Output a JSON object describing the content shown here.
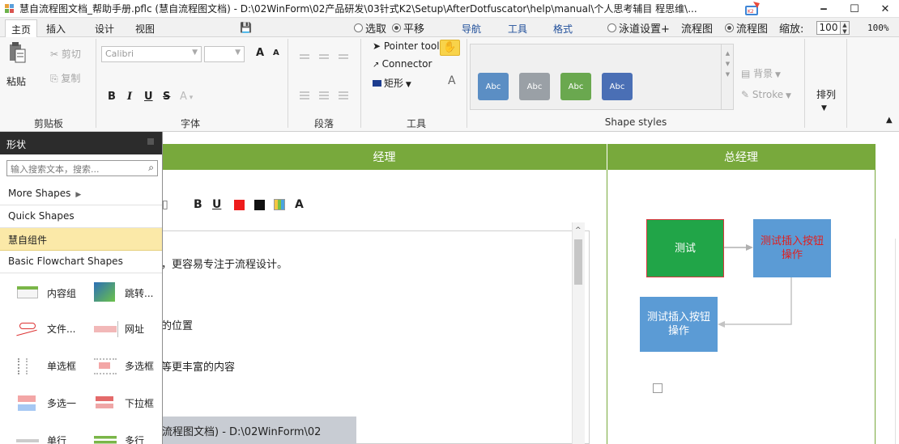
{
  "window": {
    "title": "慧自流程图文档_帮助手册.pflc (慧自流程图文档) - D:\\02WinForm\\02产品研发\\03针式K2\\Setup\\AfterDotfuscator\\help\\manual\\个人思考辅目   程思维\\...",
    "minimize": "‒",
    "maximize": "☐",
    "close": "✕"
  },
  "menu": {
    "tabs": [
      "主页",
      "插入",
      "设计",
      "视图"
    ],
    "save_icon": "💾",
    "select_label": "选取",
    "pan_label": "平移",
    "nav_label": "导航",
    "tools_label": "工具",
    "format_label": "格式",
    "swimlane_label": "泳道设置+",
    "flowchart_label1": "流程图",
    "flowchart_label2": "流程图",
    "zoom_label": "缩放:",
    "zoom_value": "100",
    "zoom_pct": "100%"
  },
  "ribbon": {
    "clipboard": {
      "paste": "粘贴",
      "cut": "剪切",
      "copy": "复制",
      "group": "剪贴板"
    },
    "font": {
      "font_name": "Calibri",
      "grow": "A",
      "shrink": "A",
      "bold": "B",
      "italic": "I",
      "underline": "U",
      "strike": "S",
      "color": "A",
      "group": "字体"
    },
    "paragraph": {
      "group": "段落"
    },
    "tools": {
      "pointer": "Pointer tool",
      "connector": "Connector",
      "rect": "矩形",
      "text": "A",
      "group": "工具"
    },
    "shape_styles": {
      "swatches": [
        {
          "label": "Abc",
          "color": "#5b8ec4"
        },
        {
          "label": "Abc",
          "color": "#9aa0a6"
        },
        {
          "label": "Abc",
          "color": "#6aa84f"
        },
        {
          "label": "Abc",
          "color": "#4a6fb5"
        }
      ],
      "background": "背景",
      "stroke": "Stroke",
      "group": "Shape styles"
    },
    "arrange": "排列"
  },
  "canvas": {
    "lanes": [
      "经理",
      "总经理"
    ],
    "format_row": [
      "B",
      "U",
      "A"
    ],
    "doc_lines": [
      "，更容易专注于流程设计。",
      "的位置",
      "等更丰富的内容"
    ],
    "doc_title_band": "流程图文档) - D:\\02WinForm\\02",
    "flow": {
      "box1": "测试",
      "box2": "测试插入按钮操作",
      "box3": "测试插入按钮操作"
    },
    "colors": {
      "lane_green": "#78a93c",
      "box_green": "#21a548",
      "box_blue": "#5b9bd5",
      "box_text_red": "#e02020"
    }
  },
  "panel": {
    "title": "形状",
    "search_placeholder": "输入搜索文本，搜索...",
    "items": [
      "More Shapes",
      "Quick Shapes",
      "慧自组件",
      "Basic Flowchart Shapes"
    ],
    "selected_item": "慧自组件",
    "shapes": [
      "内容组",
      "跳转...",
      "文件...",
      "网址",
      "单选框",
      "多选框",
      "多选一",
      "下拉框",
      "单行",
      "多行"
    ]
  }
}
